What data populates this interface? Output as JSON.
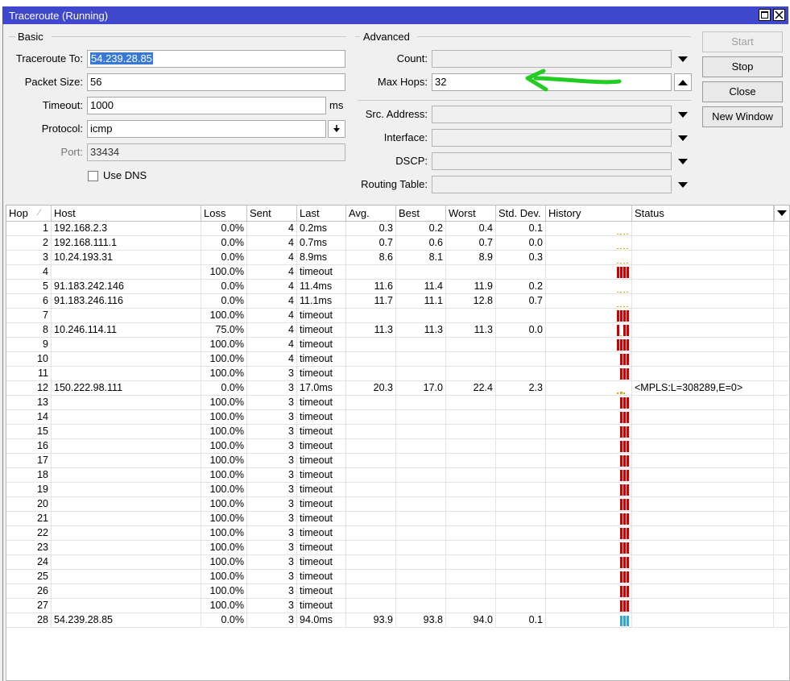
{
  "window": {
    "title": "Traceroute (Running)"
  },
  "basic": {
    "label": "Basic",
    "traceroute_to": {
      "label": "Traceroute To:",
      "value": "54.239.28.85"
    },
    "packet_size": {
      "label": "Packet Size:",
      "value": "56"
    },
    "timeout": {
      "label": "Timeout:",
      "value": "1000",
      "unit": "ms"
    },
    "protocol": {
      "label": "Protocol:",
      "value": "icmp"
    },
    "port": {
      "label": "Port:",
      "value": "33434"
    },
    "use_dns": {
      "label": "Use DNS",
      "checked": false
    }
  },
  "advanced": {
    "label": "Advanced",
    "count": {
      "label": "Count:",
      "value": ""
    },
    "max_hops": {
      "label": "Max Hops:",
      "value": "32"
    },
    "src_address": {
      "label": "Src. Address:",
      "value": ""
    },
    "interface": {
      "label": "Interface:",
      "value": ""
    },
    "dscp": {
      "label": "DSCP:",
      "value": ""
    },
    "routing_table": {
      "label": "Routing Table:",
      "value": ""
    }
  },
  "buttons": {
    "start": "Start",
    "stop": "Stop",
    "close": "Close",
    "new_window": "New Window"
  },
  "colors": {
    "title_bar": "#3f47cc",
    "history_timeout": "#cc0000",
    "history_ok": "#e8a000",
    "history_last": "#33a6cc",
    "annotation_arrow": "#22cc22"
  },
  "table": {
    "columns": [
      "Hop",
      "Host",
      "Loss",
      "Sent",
      "Last",
      "Avg.",
      "Best",
      "Worst",
      "Std. Dev.",
      "History",
      "Status"
    ],
    "rows": [
      {
        "hop": "1",
        "host": "192.168.2.3",
        "loss": "0.0%",
        "sent": "4",
        "last": "0.2ms",
        "avg": "0.3",
        "best": "0.2",
        "worst": "0.4",
        "std": "0.1",
        "status": "",
        "hist": "ok"
      },
      {
        "hop": "2",
        "host": "192.168.111.1",
        "loss": "0.0%",
        "sent": "4",
        "last": "0.7ms",
        "avg": "0.7",
        "best": "0.6",
        "worst": "0.7",
        "std": "0.0",
        "status": "",
        "hist": "ok"
      },
      {
        "hop": "3",
        "host": "10.24.193.31",
        "loss": "0.0%",
        "sent": "4",
        "last": "8.9ms",
        "avg": "8.6",
        "best": "8.1",
        "worst": "8.9",
        "std": "0.3",
        "status": "",
        "hist": "ok"
      },
      {
        "hop": "4",
        "host": "",
        "loss": "100.0%",
        "sent": "4",
        "last": "timeout",
        "avg": "",
        "best": "",
        "worst": "",
        "std": "",
        "status": "",
        "hist": "t4"
      },
      {
        "hop": "5",
        "host": "91.183.242.146",
        "loss": "0.0%",
        "sent": "4",
        "last": "11.4ms",
        "avg": "11.6",
        "best": "11.4",
        "worst": "11.9",
        "std": "0.2",
        "status": "",
        "hist": "ok"
      },
      {
        "hop": "6",
        "host": "91.183.246.116",
        "loss": "0.0%",
        "sent": "4",
        "last": "11.1ms",
        "avg": "11.7",
        "best": "11.1",
        "worst": "12.8",
        "std": "0.7",
        "status": "",
        "hist": "ok"
      },
      {
        "hop": "7",
        "host": "",
        "loss": "100.0%",
        "sent": "4",
        "last": "timeout",
        "avg": "",
        "best": "",
        "worst": "",
        "std": "",
        "status": "",
        "hist": "t4"
      },
      {
        "hop": "8",
        "host": "10.246.114.11",
        "loss": "75.0%",
        "sent": "4",
        "last": "timeout",
        "avg": "11.3",
        "best": "11.3",
        "worst": "11.3",
        "std": "0.0",
        "status": "",
        "hist": "mix"
      },
      {
        "hop": "9",
        "host": "",
        "loss": "100.0%",
        "sent": "4",
        "last": "timeout",
        "avg": "",
        "best": "",
        "worst": "",
        "std": "",
        "status": "",
        "hist": "t4"
      },
      {
        "hop": "10",
        "host": "",
        "loss": "100.0%",
        "sent": "4",
        "last": "timeout",
        "avg": "",
        "best": "",
        "worst": "",
        "std": "",
        "status": "",
        "hist": "t3"
      },
      {
        "hop": "11",
        "host": "",
        "loss": "100.0%",
        "sent": "3",
        "last": "timeout",
        "avg": "",
        "best": "",
        "worst": "",
        "std": "",
        "status": "",
        "hist": "t3"
      },
      {
        "hop": "12",
        "host": "150.222.98.111",
        "loss": "0.0%",
        "sent": "3",
        "last": "17.0ms",
        "avg": "20.3",
        "best": "17.0",
        "worst": "22.4",
        "std": "2.3",
        "status": "<MPLS:L=308289,E=0>",
        "hist": "ok3"
      },
      {
        "hop": "13",
        "host": "",
        "loss": "100.0%",
        "sent": "3",
        "last": "timeout",
        "avg": "",
        "best": "",
        "worst": "",
        "std": "",
        "status": "",
        "hist": "t3"
      },
      {
        "hop": "14",
        "host": "",
        "loss": "100.0%",
        "sent": "3",
        "last": "timeout",
        "avg": "",
        "best": "",
        "worst": "",
        "std": "",
        "status": "",
        "hist": "t3"
      },
      {
        "hop": "15",
        "host": "",
        "loss": "100.0%",
        "sent": "3",
        "last": "timeout",
        "avg": "",
        "best": "",
        "worst": "",
        "std": "",
        "status": "",
        "hist": "t3"
      },
      {
        "hop": "16",
        "host": "",
        "loss": "100.0%",
        "sent": "3",
        "last": "timeout",
        "avg": "",
        "best": "",
        "worst": "",
        "std": "",
        "status": "",
        "hist": "t3"
      },
      {
        "hop": "17",
        "host": "",
        "loss": "100.0%",
        "sent": "3",
        "last": "timeout",
        "avg": "",
        "best": "",
        "worst": "",
        "std": "",
        "status": "",
        "hist": "t3"
      },
      {
        "hop": "18",
        "host": "",
        "loss": "100.0%",
        "sent": "3",
        "last": "timeout",
        "avg": "",
        "best": "",
        "worst": "",
        "std": "",
        "status": "",
        "hist": "t3"
      },
      {
        "hop": "19",
        "host": "",
        "loss": "100.0%",
        "sent": "3",
        "last": "timeout",
        "avg": "",
        "best": "",
        "worst": "",
        "std": "",
        "status": "",
        "hist": "t3"
      },
      {
        "hop": "20",
        "host": "",
        "loss": "100.0%",
        "sent": "3",
        "last": "timeout",
        "avg": "",
        "best": "",
        "worst": "",
        "std": "",
        "status": "",
        "hist": "t3"
      },
      {
        "hop": "21",
        "host": "",
        "loss": "100.0%",
        "sent": "3",
        "last": "timeout",
        "avg": "",
        "best": "",
        "worst": "",
        "std": "",
        "status": "",
        "hist": "t3"
      },
      {
        "hop": "22",
        "host": "",
        "loss": "100.0%",
        "sent": "3",
        "last": "timeout",
        "avg": "",
        "best": "",
        "worst": "",
        "std": "",
        "status": "",
        "hist": "t3"
      },
      {
        "hop": "23",
        "host": "",
        "loss": "100.0%",
        "sent": "3",
        "last": "timeout",
        "avg": "",
        "best": "",
        "worst": "",
        "std": "",
        "status": "",
        "hist": "t3"
      },
      {
        "hop": "24",
        "host": "",
        "loss": "100.0%",
        "sent": "3",
        "last": "timeout",
        "avg": "",
        "best": "",
        "worst": "",
        "std": "",
        "status": "",
        "hist": "t3"
      },
      {
        "hop": "25",
        "host": "",
        "loss": "100.0%",
        "sent": "3",
        "last": "timeout",
        "avg": "",
        "best": "",
        "worst": "",
        "std": "",
        "status": "",
        "hist": "t3"
      },
      {
        "hop": "26",
        "host": "",
        "loss": "100.0%",
        "sent": "3",
        "last": "timeout",
        "avg": "",
        "best": "",
        "worst": "",
        "std": "",
        "status": "",
        "hist": "t3"
      },
      {
        "hop": "27",
        "host": "",
        "loss": "100.0%",
        "sent": "3",
        "last": "timeout",
        "avg": "",
        "best": "",
        "worst": "",
        "std": "",
        "status": "",
        "hist": "t3"
      },
      {
        "hop": "28",
        "host": "54.239.28.85",
        "loss": "0.0%",
        "sent": "3",
        "last": "94.0ms",
        "avg": "93.9",
        "best": "93.8",
        "worst": "94.0",
        "std": "0.1",
        "status": "",
        "hist": "last"
      }
    ]
  }
}
